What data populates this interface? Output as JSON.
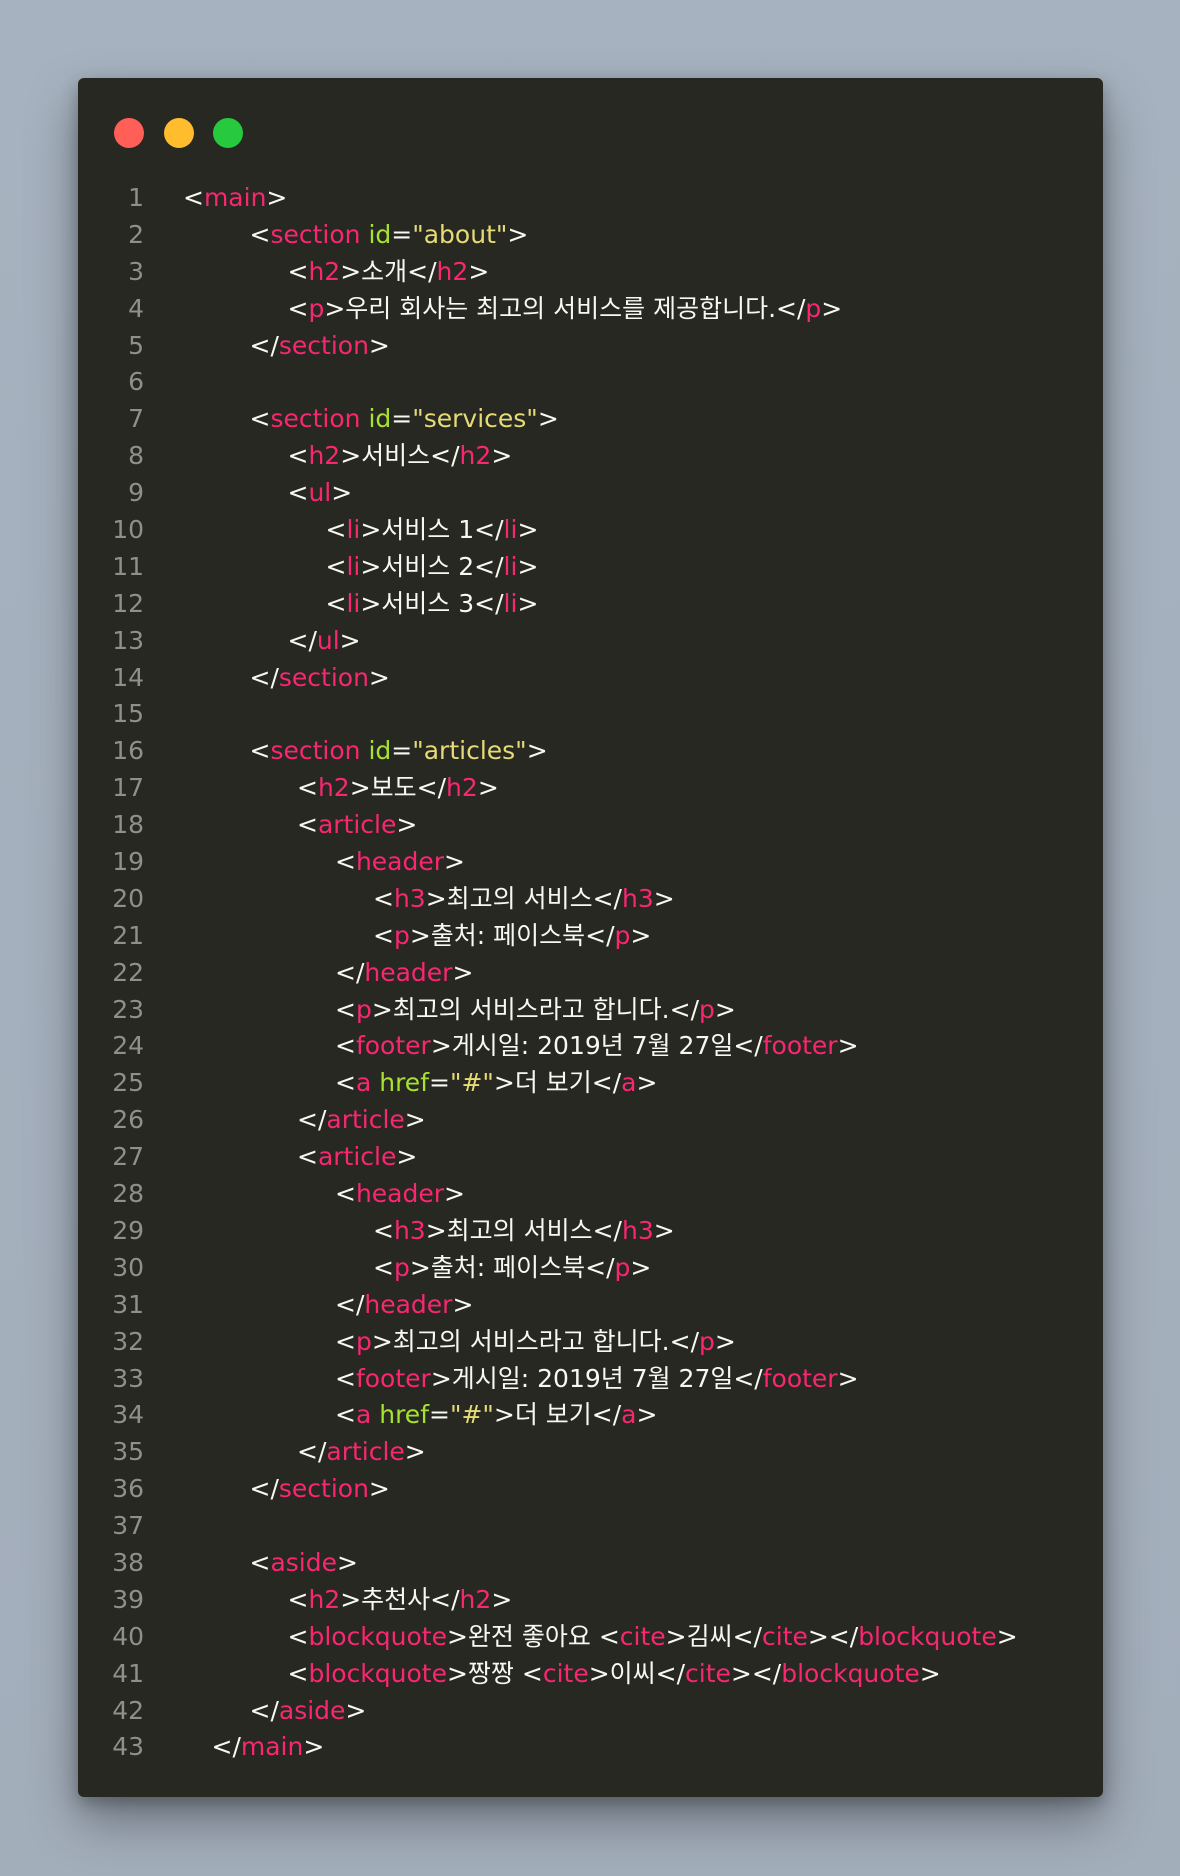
{
  "window": {
    "controls": [
      "close",
      "minimize",
      "maximize"
    ],
    "colors": {
      "close": "#ff5f56",
      "minimize": "#ffbd2e",
      "maximize": "#27c93f",
      "background": "#272822"
    }
  },
  "theme": {
    "tag": "#f92672",
    "attr": "#a6e22e",
    "string": "#e6db74",
    "text": "#f8f8f2",
    "line_number": "#8f908a"
  },
  "code": {
    "lines": [
      {
        "n": "1",
        "indent": 0,
        "tokens": [
          [
            "p",
            "<"
          ],
          [
            "t",
            "main"
          ],
          [
            "p",
            ">"
          ]
        ]
      },
      {
        "n": "2",
        "indent": 70,
        "tokens": [
          [
            "p",
            "<"
          ],
          [
            "t",
            "section"
          ],
          [
            "p",
            " "
          ],
          [
            "a",
            "id"
          ],
          [
            "p",
            "="
          ],
          [
            "s",
            "\"about\""
          ],
          [
            "p",
            ">"
          ]
        ]
      },
      {
        "n": "3",
        "indent": 110,
        "tokens": [
          [
            "p",
            "<"
          ],
          [
            "t",
            "h2"
          ],
          [
            "p",
            ">소개</"
          ],
          [
            "t",
            "h2"
          ],
          [
            "p",
            ">"
          ]
        ]
      },
      {
        "n": "4",
        "indent": 110,
        "tokens": [
          [
            "p",
            "<"
          ],
          [
            "t",
            "p"
          ],
          [
            "p",
            ">우리 회사는 최고의 서비스를 제공합니다.</"
          ],
          [
            "t",
            "p"
          ],
          [
            "p",
            ">"
          ]
        ]
      },
      {
        "n": "5",
        "indent": 70,
        "tokens": [
          [
            "p",
            "</"
          ],
          [
            "t",
            "section"
          ],
          [
            "p",
            ">"
          ]
        ]
      },
      {
        "n": "6",
        "indent": 0,
        "tokens": []
      },
      {
        "n": "7",
        "indent": 70,
        "tokens": [
          [
            "p",
            "<"
          ],
          [
            "t",
            "section"
          ],
          [
            "p",
            " "
          ],
          [
            "a",
            "id"
          ],
          [
            "p",
            "="
          ],
          [
            "s",
            "\"services\""
          ],
          [
            "p",
            ">"
          ]
        ]
      },
      {
        "n": "8",
        "indent": 110,
        "tokens": [
          [
            "p",
            "<"
          ],
          [
            "t",
            "h2"
          ],
          [
            "p",
            ">서비스</"
          ],
          [
            "t",
            "h2"
          ],
          [
            "p",
            ">"
          ]
        ]
      },
      {
        "n": "9",
        "indent": 110,
        "tokens": [
          [
            "p",
            "<"
          ],
          [
            "t",
            "ul"
          ],
          [
            "p",
            ">"
          ]
        ]
      },
      {
        "n": "10",
        "indent": 150,
        "tokens": [
          [
            "p",
            "<"
          ],
          [
            "t",
            "li"
          ],
          [
            "p",
            ">서비스 1</"
          ],
          [
            "t",
            "li"
          ],
          [
            "p",
            ">"
          ]
        ]
      },
      {
        "n": "11",
        "indent": 150,
        "tokens": [
          [
            "p",
            "<"
          ],
          [
            "t",
            "li"
          ],
          [
            "p",
            ">서비스 2</"
          ],
          [
            "t",
            "li"
          ],
          [
            "p",
            ">"
          ]
        ]
      },
      {
        "n": "12",
        "indent": 150,
        "tokens": [
          [
            "p",
            "<"
          ],
          [
            "t",
            "li"
          ],
          [
            "p",
            ">서비스 3</"
          ],
          [
            "t",
            "li"
          ],
          [
            "p",
            ">"
          ]
        ]
      },
      {
        "n": "13",
        "indent": 110,
        "tokens": [
          [
            "p",
            "</"
          ],
          [
            "t",
            "ul"
          ],
          [
            "p",
            ">"
          ]
        ]
      },
      {
        "n": "14",
        "indent": 70,
        "tokens": [
          [
            "p",
            "</"
          ],
          [
            "t",
            "section"
          ],
          [
            "p",
            ">"
          ]
        ]
      },
      {
        "n": "15",
        "indent": 0,
        "tokens": []
      },
      {
        "n": "16",
        "indent": 70,
        "tokens": [
          [
            "p",
            "<"
          ],
          [
            "t",
            "section"
          ],
          [
            "p",
            " "
          ],
          [
            "a",
            "id"
          ],
          [
            "p",
            "="
          ],
          [
            "s",
            "\"articles\""
          ],
          [
            "p",
            ">"
          ]
        ]
      },
      {
        "n": "17",
        "indent": 120,
        "tokens": [
          [
            "p",
            "<"
          ],
          [
            "t",
            "h2"
          ],
          [
            "p",
            ">보도</"
          ],
          [
            "t",
            "h2"
          ],
          [
            "p",
            ">"
          ]
        ]
      },
      {
        "n": "18",
        "indent": 120,
        "tokens": [
          [
            "p",
            "<"
          ],
          [
            "t",
            "article"
          ],
          [
            "p",
            ">"
          ]
        ]
      },
      {
        "n": "19",
        "indent": 160,
        "tokens": [
          [
            "p",
            "<"
          ],
          [
            "t",
            "header"
          ],
          [
            "p",
            ">"
          ]
        ]
      },
      {
        "n": "20",
        "indent": 200,
        "tokens": [
          [
            "p",
            "<"
          ],
          [
            "t",
            "h3"
          ],
          [
            "p",
            ">최고의 서비스</"
          ],
          [
            "t",
            "h3"
          ],
          [
            "p",
            ">"
          ]
        ]
      },
      {
        "n": "21",
        "indent": 200,
        "tokens": [
          [
            "p",
            "<"
          ],
          [
            "t",
            "p"
          ],
          [
            "p",
            ">출처: 페이스북</"
          ],
          [
            "t",
            "p"
          ],
          [
            "p",
            ">"
          ]
        ]
      },
      {
        "n": "22",
        "indent": 160,
        "tokens": [
          [
            "p",
            "</"
          ],
          [
            "t",
            "header"
          ],
          [
            "p",
            ">"
          ]
        ]
      },
      {
        "n": "23",
        "indent": 160,
        "tokens": [
          [
            "p",
            "<"
          ],
          [
            "t",
            "p"
          ],
          [
            "p",
            ">최고의 서비스라고 합니다.</"
          ],
          [
            "t",
            "p"
          ],
          [
            "p",
            ">"
          ]
        ]
      },
      {
        "n": "24",
        "indent": 160,
        "tokens": [
          [
            "p",
            "<"
          ],
          [
            "t",
            "footer"
          ],
          [
            "p",
            ">게시일: 2019년 7월 27일</"
          ],
          [
            "t",
            "footer"
          ],
          [
            "p",
            ">"
          ]
        ]
      },
      {
        "n": "25",
        "indent": 160,
        "tokens": [
          [
            "p",
            "<"
          ],
          [
            "t",
            "a"
          ],
          [
            "p",
            " "
          ],
          [
            "a",
            "href"
          ],
          [
            "p",
            "="
          ],
          [
            "s",
            "\"#\""
          ],
          [
            "p",
            ">더 보기</"
          ],
          [
            "t",
            "a"
          ],
          [
            "p",
            ">"
          ]
        ]
      },
      {
        "n": "26",
        "indent": 120,
        "tokens": [
          [
            "p",
            "</"
          ],
          [
            "t",
            "article"
          ],
          [
            "p",
            ">"
          ]
        ]
      },
      {
        "n": "27",
        "indent": 120,
        "tokens": [
          [
            "p",
            "<"
          ],
          [
            "t",
            "article"
          ],
          [
            "p",
            ">"
          ]
        ]
      },
      {
        "n": "28",
        "indent": 160,
        "tokens": [
          [
            "p",
            "<"
          ],
          [
            "t",
            "header"
          ],
          [
            "p",
            ">"
          ]
        ]
      },
      {
        "n": "29",
        "indent": 200,
        "tokens": [
          [
            "p",
            "<"
          ],
          [
            "t",
            "h3"
          ],
          [
            "p",
            ">최고의 서비스</"
          ],
          [
            "t",
            "h3"
          ],
          [
            "p",
            ">"
          ]
        ]
      },
      {
        "n": "30",
        "indent": 200,
        "tokens": [
          [
            "p",
            "<"
          ],
          [
            "t",
            "p"
          ],
          [
            "p",
            ">출처: 페이스북</"
          ],
          [
            "t",
            "p"
          ],
          [
            "p",
            ">"
          ]
        ]
      },
      {
        "n": "31",
        "indent": 160,
        "tokens": [
          [
            "p",
            "</"
          ],
          [
            "t",
            "header"
          ],
          [
            "p",
            ">"
          ]
        ]
      },
      {
        "n": "32",
        "indent": 160,
        "tokens": [
          [
            "p",
            "<"
          ],
          [
            "t",
            "p"
          ],
          [
            "p",
            ">최고의 서비스라고 합니다.</"
          ],
          [
            "t",
            "p"
          ],
          [
            "p",
            ">"
          ]
        ]
      },
      {
        "n": "33",
        "indent": 160,
        "tokens": [
          [
            "p",
            "<"
          ],
          [
            "t",
            "footer"
          ],
          [
            "p",
            ">게시일: 2019년 7월 27일</"
          ],
          [
            "t",
            "footer"
          ],
          [
            "p",
            ">"
          ]
        ]
      },
      {
        "n": "34",
        "indent": 160,
        "tokens": [
          [
            "p",
            "<"
          ],
          [
            "t",
            "a"
          ],
          [
            "p",
            " "
          ],
          [
            "a",
            "href"
          ],
          [
            "p",
            "="
          ],
          [
            "s",
            "\"#\""
          ],
          [
            "p",
            ">더 보기</"
          ],
          [
            "t",
            "a"
          ],
          [
            "p",
            ">"
          ]
        ]
      },
      {
        "n": "35",
        "indent": 120,
        "tokens": [
          [
            "p",
            "</"
          ],
          [
            "t",
            "article"
          ],
          [
            "p",
            ">"
          ]
        ]
      },
      {
        "n": "36",
        "indent": 70,
        "tokens": [
          [
            "p",
            "</"
          ],
          [
            "t",
            "section"
          ],
          [
            "p",
            ">"
          ]
        ]
      },
      {
        "n": "37",
        "indent": 0,
        "tokens": []
      },
      {
        "n": "38",
        "indent": 70,
        "tokens": [
          [
            "p",
            "<"
          ],
          [
            "t",
            "aside"
          ],
          [
            "p",
            ">"
          ]
        ]
      },
      {
        "n": "39",
        "indent": 110,
        "tokens": [
          [
            "p",
            "<"
          ],
          [
            "t",
            "h2"
          ],
          [
            "p",
            ">추천사</"
          ],
          [
            "t",
            "h2"
          ],
          [
            "p",
            ">"
          ]
        ]
      },
      {
        "n": "40",
        "indent": 110,
        "tokens": [
          [
            "p",
            "<"
          ],
          [
            "t",
            "blockquote"
          ],
          [
            "p",
            ">완전 좋아요 <"
          ],
          [
            "t",
            "cite"
          ],
          [
            "p",
            ">김씨</"
          ],
          [
            "t",
            "cite"
          ],
          [
            "p",
            "></"
          ],
          [
            "t",
            "blockquote"
          ],
          [
            "p",
            ">"
          ]
        ]
      },
      {
        "n": "41",
        "indent": 110,
        "tokens": [
          [
            "p",
            "<"
          ],
          [
            "t",
            "blockquote"
          ],
          [
            "p",
            ">짱짱 <"
          ],
          [
            "t",
            "cite"
          ],
          [
            "p",
            ">이씨</"
          ],
          [
            "t",
            "cite"
          ],
          [
            "p",
            "></"
          ],
          [
            "t",
            "blockquote"
          ],
          [
            "p",
            ">"
          ]
        ]
      },
      {
        "n": "42",
        "indent": 70,
        "tokens": [
          [
            "p",
            "</"
          ],
          [
            "t",
            "aside"
          ],
          [
            "p",
            ">"
          ]
        ]
      },
      {
        "n": "43",
        "indent": 30,
        "tokens": [
          [
            "p",
            "</"
          ],
          [
            "t",
            "main"
          ],
          [
            "p",
            ">"
          ]
        ]
      }
    ]
  }
}
